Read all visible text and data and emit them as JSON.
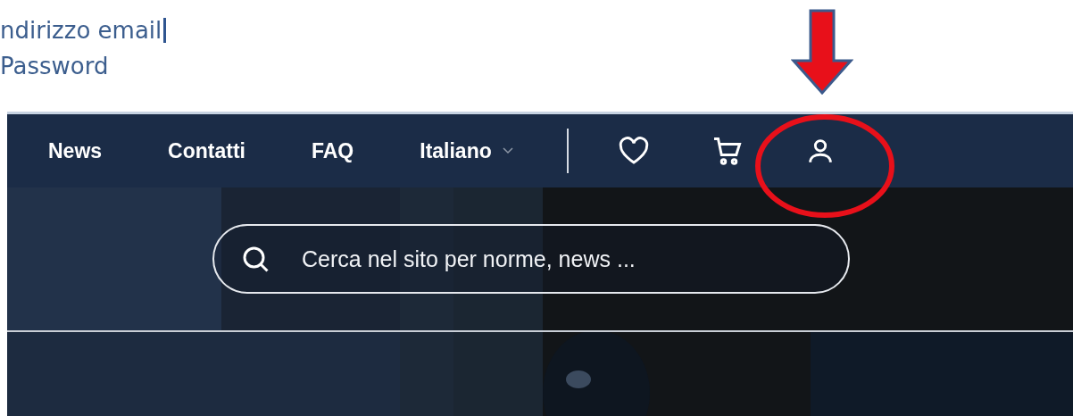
{
  "form_labels": [
    "ndirizzo email",
    "Password"
  ],
  "nav": {
    "links": [
      "News",
      "Contatti",
      "FAQ"
    ],
    "language": "Italiano"
  },
  "search": {
    "placeholder": "Cerca nel sito per norme, news ..."
  }
}
